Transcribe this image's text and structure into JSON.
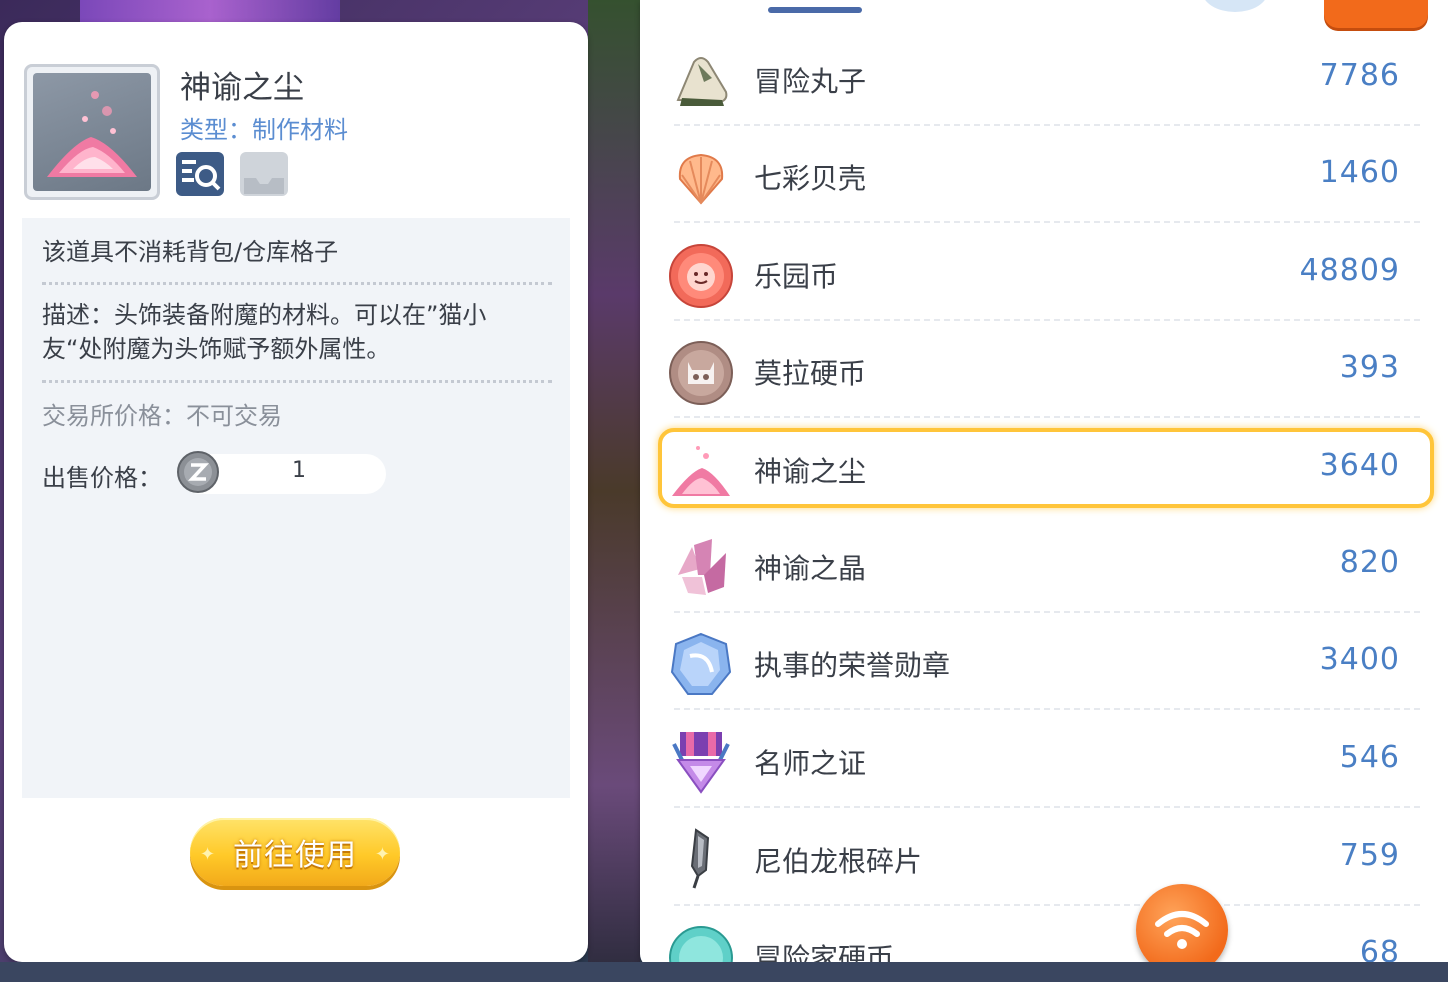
{
  "detail": {
    "item_name": "神谕之尘",
    "item_type": "类型：制作材料",
    "note": "该道具不消耗背包/仓库格子",
    "description": "描述：头饰装备附魔的材料。可以在”猫小友“处附魔为头饰赋予额外属性。",
    "trade_price": "交易所价格：不可交易",
    "sell_label": "出售价格：",
    "sell_value": "1",
    "use_button": "前往使用"
  },
  "inventory": {
    "items": [
      {
        "name": "冒险丸子",
        "count": "7786",
        "icon": "rice-ball-icon"
      },
      {
        "name": "七彩贝壳",
        "count": "1460",
        "icon": "seashell-icon"
      },
      {
        "name": "乐园币",
        "count": "48809",
        "icon": "paradise-coin-icon"
      },
      {
        "name": "莫拉硬币",
        "count": "393",
        "icon": "mora-coin-icon"
      },
      {
        "name": "神谕之尘",
        "count": "3640",
        "icon": "oracle-dust-icon",
        "selected": true
      },
      {
        "name": "神谕之晶",
        "count": "820",
        "icon": "oracle-crystal-icon"
      },
      {
        "name": "执事的荣誉勋章",
        "count": "3400",
        "icon": "butler-medal-icon"
      },
      {
        "name": "名师之证",
        "count": "546",
        "icon": "mentor-badge-icon"
      },
      {
        "name": "尼伯龙根碎片",
        "count": "759",
        "icon": "nibelungen-shard-icon"
      },
      {
        "name": "冒险家硬币",
        "count": "68",
        "icon": "adventurer-coin-icon"
      }
    ]
  },
  "colors": {
    "accent_blue": "#4a7fc4",
    "selected_border": "#ffc53a",
    "button_yellow": "#ffc928",
    "wifi_orange": "#f26a1b"
  }
}
